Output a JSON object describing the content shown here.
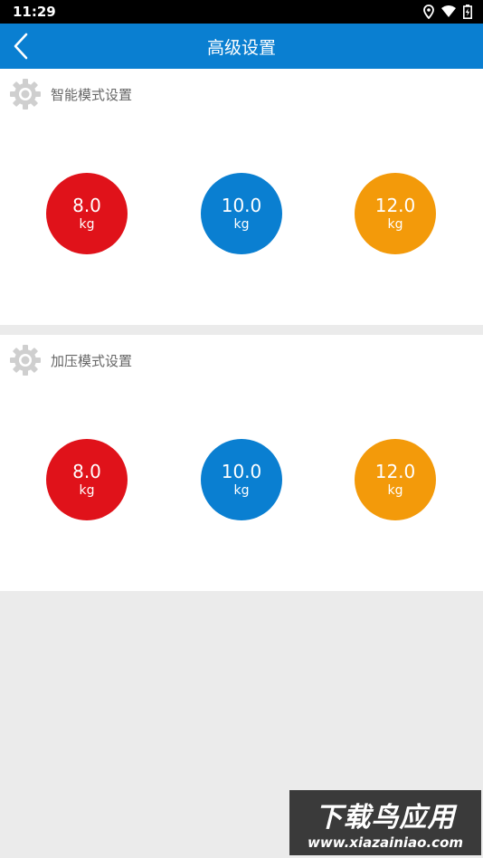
{
  "status_bar": {
    "time": "11:29"
  },
  "app_bar": {
    "title": "高级设置"
  },
  "sections": [
    {
      "title": "智能模式设置",
      "options": [
        {
          "value": "8.0",
          "unit": "kg",
          "color": "#e0121a"
        },
        {
          "value": "10.0",
          "unit": "kg",
          "color": "#0a7fd1"
        },
        {
          "value": "12.0",
          "unit": "kg",
          "color": "#f39a0a"
        }
      ]
    },
    {
      "title": "加压模式设置",
      "options": [
        {
          "value": "8.0",
          "unit": "kg",
          "color": "#e0121a"
        },
        {
          "value": "10.0",
          "unit": "kg",
          "color": "#0a7fd1"
        },
        {
          "value": "12.0",
          "unit": "kg",
          "color": "#f39a0a"
        }
      ]
    }
  ],
  "watermark": {
    "brand": "下载鸟应用",
    "url": "www.xiazainiao.com"
  },
  "icons": [
    "location-icon",
    "wifi-icon",
    "battery-icon",
    "back-arrow-icon",
    "gear-icon"
  ]
}
